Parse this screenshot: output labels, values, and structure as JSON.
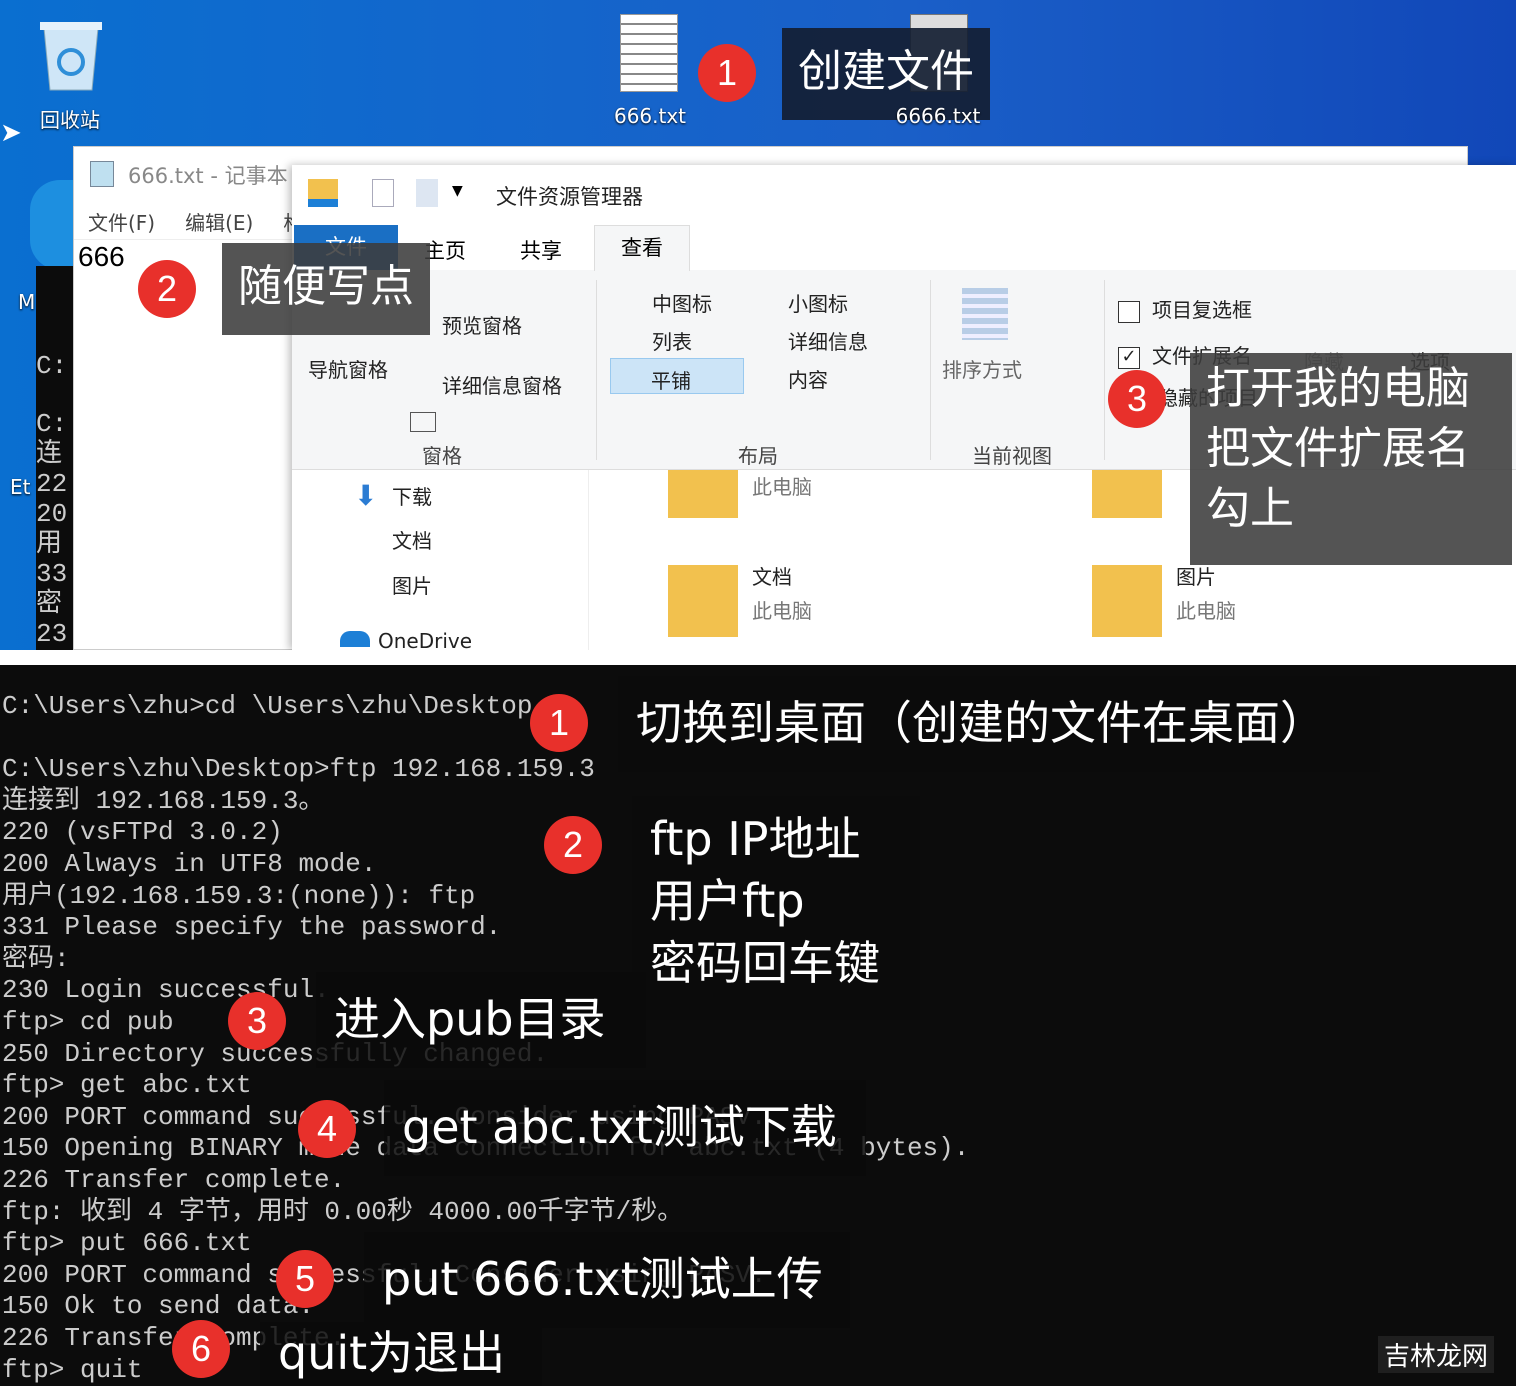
{
  "desktop": {
    "recycle_bin": "回收站",
    "file1": "666.txt",
    "file2": "6666.txt",
    "left_labels": [
      "M",
      "Et",
      "t"
    ]
  },
  "notepad": {
    "title": "666.txt - 记事本",
    "menu": [
      "文件(F)",
      "编辑(E)",
      "格"
    ],
    "content": "666"
  },
  "explorer": {
    "title": "文件资源管理器",
    "tabs": [
      "文件",
      "主页",
      "共享",
      "查看"
    ],
    "panes": {
      "nav": "导航窗格",
      "preview": "预览窗格",
      "details": "详细信息窗格",
      "group": "窗格"
    },
    "layout": {
      "items": [
        "中图标",
        "小图标",
        "列表",
        "详细信息",
        "平铺",
        "内容"
      ],
      "selected": "平铺",
      "group": "布局"
    },
    "view": {
      "sort": "排序方式",
      "group": "当前视图"
    },
    "showhide": {
      "item_checkbox": "项目复选框",
      "item_checkbox_checked": false,
      "extensions": "文件扩展名",
      "extensions_checked": true,
      "hidden_items": "隐藏的项目",
      "hide": "隐藏",
      "options": "选项"
    },
    "quick": [
      {
        "label": "下载"
      },
      {
        "label": "文档"
      },
      {
        "label": "图片"
      }
    ],
    "onedrive": "OneDrive",
    "folders": [
      {
        "name": "",
        "sub": "此电脑"
      },
      {
        "name": "",
        "sub": "此电脑"
      },
      {
        "name": "文档",
        "sub": "此电脑"
      },
      {
        "name": "图片",
        "sub": "此电脑"
      }
    ]
  },
  "callouts_top": [
    {
      "n": "1",
      "text": "创建文件"
    },
    {
      "n": "2",
      "text": "随便写点"
    },
    {
      "n": "3",
      "lines": [
        "打开我的电脑",
        "把文件扩展名",
        "勾上"
      ]
    }
  ],
  "terminal": {
    "lines": [
      "C:\\Users\\zhu>cd \\Users\\zhu\\Desktop",
      "",
      "C:\\Users\\zhu\\Desktop>ftp 192.168.159.3",
      "连接到 192.168.159.3。",
      "220 (vsFTPd 3.0.2)",
      "200 Always in UTF8 mode.",
      "用户(192.168.159.3:(none)): ftp",
      "331 Please specify the password.",
      "密码:",
      "230 Login successful.",
      "ftp> cd pub",
      "250 Directory successfully changed.",
      "ftp> get abc.txt",
      "200 PORT command successful. Consider using PASV.",
      "150 Opening BINARY mode data connection for abc.txt (4 bytes).",
      "226 Transfer complete.",
      "ftp: 收到 4 字节，用时 0.00秒 4000.00千字节/秒。",
      "ftp> put 666.txt",
      "200 PORT command successful. Consider using PASV.",
      "150 Ok to send data.",
      "226 Transfer complete.",
      "ftp> quit"
    ],
    "left_strip": [
      "C:",
      "C:",
      "连",
      "22",
      "20",
      "用",
      "33",
      "密",
      "23"
    ]
  },
  "callouts_bottom": [
    {
      "n": "1",
      "text": "切换到桌面（创建的文件在桌面）"
    },
    {
      "n": "2",
      "lines": [
        "ftp IP地址",
        "用户ftp",
        "密码回车键"
      ]
    },
    {
      "n": "3",
      "text": "进入pub目录"
    },
    {
      "n": "4",
      "text": "get abc.txt测试下载"
    },
    {
      "n": "5",
      "text": "put 666.txt测试上传"
    },
    {
      "n": "6",
      "text": "quit为退出"
    }
  ],
  "watermark": "吉林龙网",
  "colors": {
    "badge": "#e8302b",
    "desktop": "#0a6fd0",
    "ribbon_file_tab": "#1a6fc4",
    "terminal_bg": "#0c0c0c"
  }
}
